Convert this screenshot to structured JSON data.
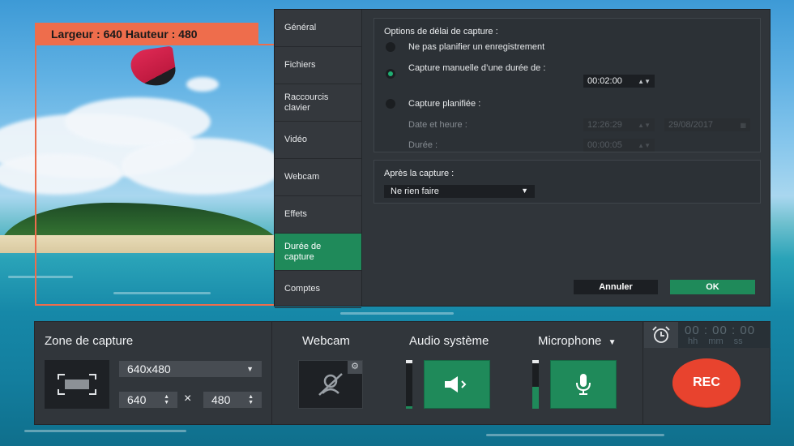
{
  "capture_frame": {
    "label": "Largeur : 640  Hauteur : 480"
  },
  "settings": {
    "tabs": [
      {
        "label": "Général",
        "active": false
      },
      {
        "label": "Fichiers",
        "active": false
      },
      {
        "label": "Raccourcis clavier",
        "active": false
      },
      {
        "label": "Vidéo",
        "active": false
      },
      {
        "label": "Webcam",
        "active": false
      },
      {
        "label": "Effets",
        "active": false
      },
      {
        "label": "Durée de capture",
        "active": true
      },
      {
        "label": "Comptes",
        "active": false
      }
    ],
    "delay_options": {
      "title": "Options de délai de capture :",
      "opt_no_schedule": "Ne pas planifier un enregistrement",
      "opt_manual": "Capture manuelle d’une durée de :",
      "manual_duration": "00:02:00",
      "opt_scheduled": "Capture planifiée :",
      "date_label": "Date et heure :",
      "time_value": "12:26:29",
      "date_value": "29/08/2017",
      "duration_label": "Durée :",
      "duration_value": "00:00:05",
      "selected": "manual"
    },
    "after_capture": {
      "title": "Après la capture :",
      "value": "Ne rien faire"
    },
    "cancel_label": "Annuler",
    "ok_label": "OK"
  },
  "toolbar": {
    "zone_title": "Zone de capture",
    "resolution_value": "640x480",
    "width_value": "640",
    "times_symbol": "×",
    "height_value": "480",
    "webcam_title": "Webcam",
    "audio_title": "Audio système",
    "audio_level": 0.05,
    "mic_title": "Microphone",
    "mic_level": 0.45,
    "timer_digits": "00 : 00 : 00",
    "timer_units": "hh mm ss",
    "rec_label": "REC"
  },
  "colors": {
    "accent_green": "#1f8a5a",
    "capture_orange": "#ee6d4c",
    "rec_red": "#e8432e"
  }
}
